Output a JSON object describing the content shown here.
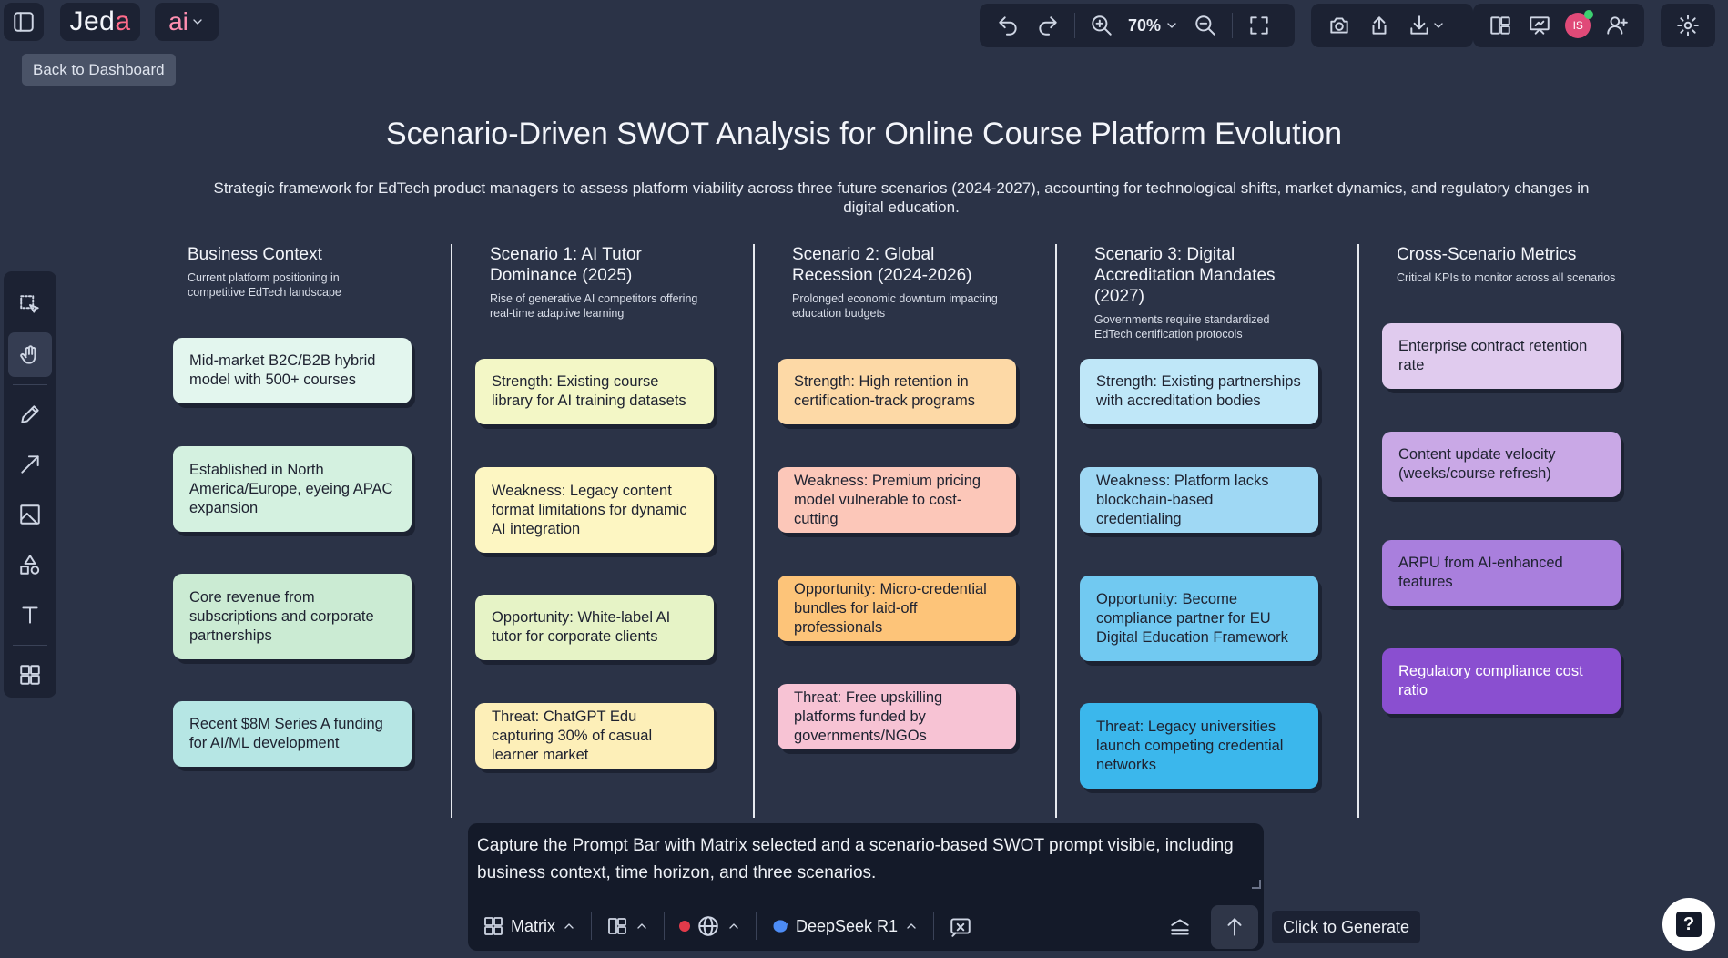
{
  "app": {
    "brand_prefix": "Jed",
    "brand_accent": "a",
    "ai_label": "ai",
    "back_tooltip": "Back to Dashboard"
  },
  "toolbar": {
    "zoom_level": "70%",
    "avatar_initials": "IS"
  },
  "canvas": {
    "title": "Scenario-Driven SWOT Analysis for Online Course Platform Evolution",
    "subtitle": "Strategic framework for EdTech product managers to assess platform viability across three future scenarios (2024-2027), accounting for technological shifts, market dynamics, and regulatory changes in digital education.",
    "columns": [
      {
        "heading": "Business Context",
        "description": "Current platform positioning in competitive EdTech landscape",
        "cards": [
          {
            "text": "Mid-market B2C/B2B hybrid model with 500+ courses",
            "color": "#e3f6ee"
          },
          {
            "text": "Established in North America/Europe, eyeing APAC expansion",
            "color": "#d4f1e0"
          },
          {
            "text": "Core revenue from subscriptions and corporate partnerships",
            "color": "#cbebd3"
          },
          {
            "text": "Recent $8M Series A funding for AI/ML development",
            "color": "#b6e6e4"
          }
        ]
      },
      {
        "heading": "Scenario 1: AI Tutor Dominance (2025)",
        "description": "Rise of generative AI competitors offering real-time adaptive learning",
        "cards": [
          {
            "text": "Strength: Existing course library for AI training datasets",
            "color": "#f3f7c6"
          },
          {
            "text": "Weakness: Legacy content format limitations for dynamic AI integration",
            "color": "#fdf6c2"
          },
          {
            "text": "Opportunity: White-label AI tutor for corporate clients",
            "color": "#e6f3c6"
          },
          {
            "text": "Threat: ChatGPT Edu capturing 30% of casual learner market",
            "color": "#fdefb8"
          }
        ]
      },
      {
        "heading": "Scenario 2: Global Recession (2024-2026)",
        "description": "Prolonged economic downturn impacting education budgets",
        "cards": [
          {
            "text": "Strength: High retention in certification-track programs",
            "color": "#fdd9a6"
          },
          {
            "text": "Weakness: Premium pricing model vulnerable to cost-cutting",
            "color": "#fcc7b9"
          },
          {
            "text": "Opportunity: Micro-credential bundles for laid-off professionals",
            "color": "#fdc479"
          },
          {
            "text": "Threat: Free upskilling platforms funded by governments/NGOs",
            "color": "#f7c3d4"
          }
        ]
      },
      {
        "heading": "Scenario 3: Digital Accreditation Mandates (2027)",
        "description": "Governments require standardized EdTech certification protocols",
        "cards": [
          {
            "text": "Strength: Existing partnerships with accreditation bodies",
            "color": "#bfe7f8"
          },
          {
            "text": "Weakness: Platform lacks blockchain-based credentialing",
            "color": "#9fd8f4"
          },
          {
            "text": "Opportunity: Become compliance partner for EU Digital Education Framework",
            "color": "#71c9f1"
          },
          {
            "text": "Threat: Legacy universities launch competing credential networks",
            "color": "#3bb7ec"
          }
        ]
      },
      {
        "heading": "Cross-Scenario Metrics",
        "description": "Critical KPIs to monitor across all scenarios",
        "cards": [
          {
            "text": "Enterprise contract retention rate",
            "color": "#e0cbee"
          },
          {
            "text": "Content update velocity (weeks/course refresh)",
            "color": "#c9a8e6"
          },
          {
            "text": "ARPU from AI-enhanced features",
            "color": "#a97fdd"
          },
          {
            "text": "Regulatory compliance cost ratio",
            "color": "#8a4fd0"
          }
        ]
      }
    ]
  },
  "prompt": {
    "text": "Capture the Prompt Bar with Matrix selected and a scenario-based SWOT prompt visible, including business context, time horizon, and three scenarios.",
    "mode_label": "Matrix",
    "model_label": "DeepSeek R1",
    "generate_tooltip": "Click to Generate"
  },
  "help": {
    "label": "?"
  }
}
